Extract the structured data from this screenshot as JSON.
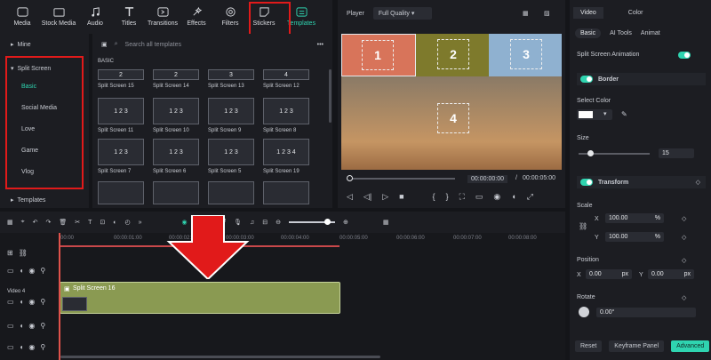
{
  "toolbar": {
    "items": [
      {
        "label": "Media",
        "icon": "media-icon"
      },
      {
        "label": "Stock Media",
        "icon": "stock-media-icon"
      },
      {
        "label": "Audio",
        "icon": "music-note-icon"
      },
      {
        "label": "Titles",
        "icon": "title-t-icon"
      },
      {
        "label": "Transitions",
        "icon": "transition-icon"
      },
      {
        "label": "Effects",
        "icon": "effects-icon"
      },
      {
        "label": "Filters",
        "icon": "filter-icon"
      },
      {
        "label": "Stickers",
        "icon": "sticker-icon"
      },
      {
        "label": "Templates",
        "icon": "template-icon"
      }
    ]
  },
  "sidebar": {
    "mine": "Mine",
    "split_screen": "Split Screen",
    "subitems": [
      "Basic",
      "Social Media",
      "Love",
      "Game",
      "Vlog"
    ],
    "templates": "Templates"
  },
  "templates_panel": {
    "search_placeholder": "Search all templates",
    "section": "BASIC",
    "rows": [
      [
        "Split Screen 15",
        "Split Screen 14",
        "Split Screen 13",
        "Split Screen 12"
      ],
      [
        "Split Screen 11",
        "Split Screen 10",
        "Split Screen 9",
        "Split Screen 8"
      ],
      [
        "Split Screen 7",
        "Split Screen 6",
        "Split Screen 5",
        "Split Screen 19"
      ]
    ]
  },
  "player": {
    "label": "Player",
    "quality": "Full Quality",
    "current_time": "00:00:00:00",
    "total_time": "00:00:05:00",
    "slots": [
      "1",
      "2",
      "3",
      "4"
    ]
  },
  "right_panel": {
    "tabs": [
      "Video",
      "Color"
    ],
    "subtabs": [
      "Basic",
      "AI Tools",
      "Animat"
    ],
    "split_anim": "Split Screen Animation",
    "border": "Border",
    "select_color": "Select Color",
    "size": "Size",
    "size_value": "15",
    "transform": "Transform",
    "scale": "Scale",
    "scale_x": "100.00",
    "scale_y": "100.00",
    "pct": "%",
    "position": "Position",
    "pos_x": "0.00",
    "pos_y": "0.00",
    "px": "px",
    "x_label": "X",
    "y_label": "Y",
    "rotate": "Rotate",
    "rotate_value": "0.00°",
    "reset": "Reset",
    "keyframe": "Keyframe Panel",
    "advanced": "Advanced"
  },
  "timeline": {
    "ticks": [
      "00:00",
      "00:00:01:00",
      "00:00:02:00",
      "00:00:03:00",
      "00:00:04:00",
      "00:00:05:00",
      "00:00:06:00",
      "00:00:07:00",
      "00:00:08:00"
    ],
    "track_label": "Video 4",
    "clip_label": "Split Screen 16"
  },
  "colors": {
    "accent": "#2fd4b0",
    "highlight": "#e11a1a",
    "clip": "#8a9a52"
  }
}
